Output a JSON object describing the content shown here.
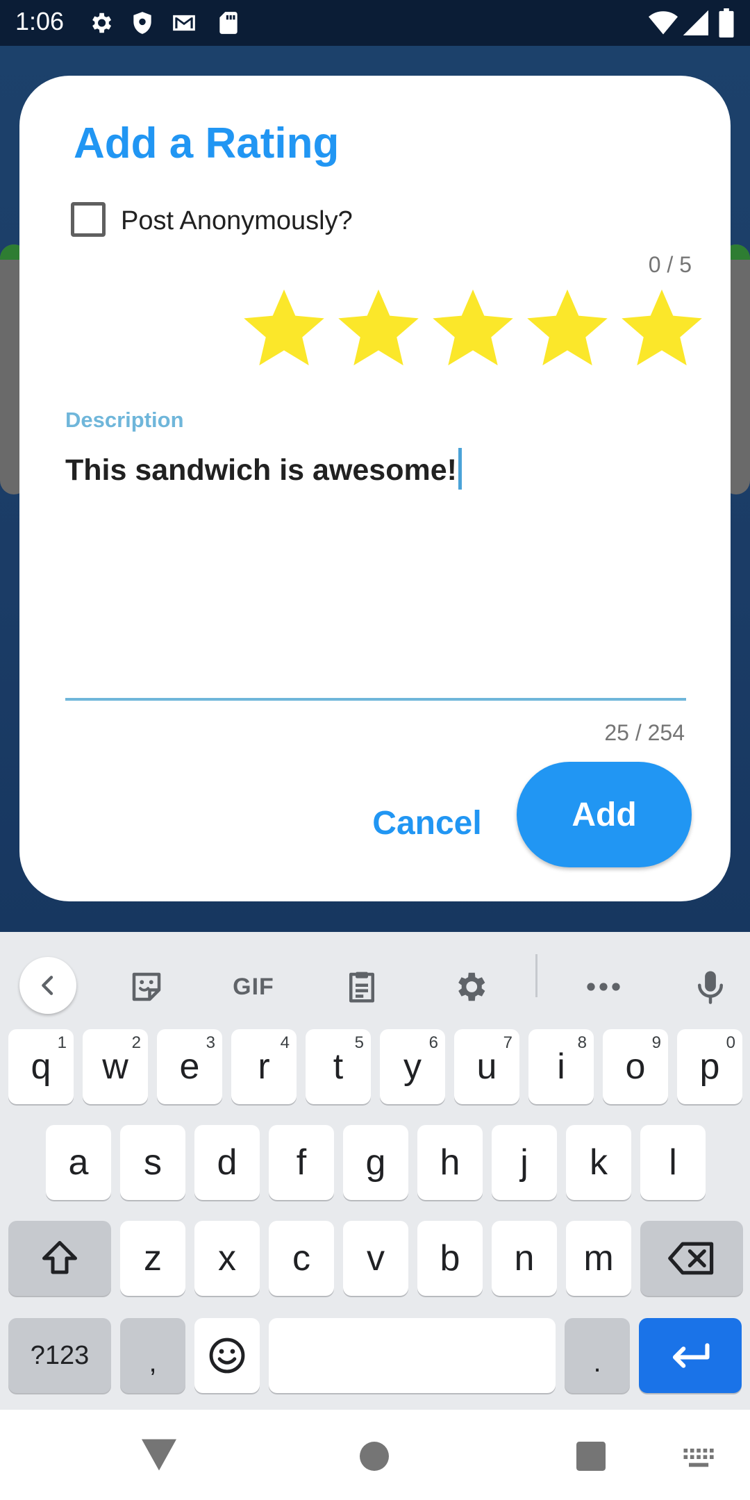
{
  "status_bar": {
    "time": "1:06",
    "left_icons": [
      "gear-icon",
      "shield-icon",
      "gmail-icon",
      "sd-card-icon"
    ],
    "right_icons": [
      "wifi-icon",
      "signal-icon",
      "battery-icon"
    ]
  },
  "dialog": {
    "title": "Add a Rating",
    "anonymous_label": "Post Anonymously?",
    "anonymous_checked": false,
    "rating_count": "0 / 5",
    "rating_value": 0,
    "rating_max": 5,
    "star_color": "#fbe72a",
    "description_label": "Description",
    "description_value": "This sandwich is awesome!",
    "char_count": "25 / 254",
    "cancel_label": "Cancel",
    "add_label": "Add",
    "accent_color": "#2196f3"
  },
  "keyboard": {
    "toolbar": {
      "gif_label": "GIF",
      "items": [
        "back-icon",
        "sticker-icon",
        "gif",
        "clipboard-icon",
        "settings-icon",
        "more-icon",
        "mic-icon"
      ]
    },
    "row1": [
      {
        "key": "q",
        "hint": "1"
      },
      {
        "key": "w",
        "hint": "2"
      },
      {
        "key": "e",
        "hint": "3"
      },
      {
        "key": "r",
        "hint": "4"
      },
      {
        "key": "t",
        "hint": "5"
      },
      {
        "key": "y",
        "hint": "6"
      },
      {
        "key": "u",
        "hint": "7"
      },
      {
        "key": "i",
        "hint": "8"
      },
      {
        "key": "o",
        "hint": "9"
      },
      {
        "key": "p",
        "hint": "0"
      }
    ],
    "row2": [
      "a",
      "s",
      "d",
      "f",
      "g",
      "h",
      "j",
      "k",
      "l"
    ],
    "row3": [
      "z",
      "x",
      "c",
      "v",
      "b",
      "n",
      "m"
    ],
    "symbols_label": "?123",
    "comma_label": ",",
    "period_label": ".",
    "enter_color": "#1a73e8"
  },
  "nav_bar": {
    "items": [
      "back-triangle-icon",
      "home-circle-icon",
      "recents-square-icon",
      "keyboard-switch-icon"
    ]
  }
}
